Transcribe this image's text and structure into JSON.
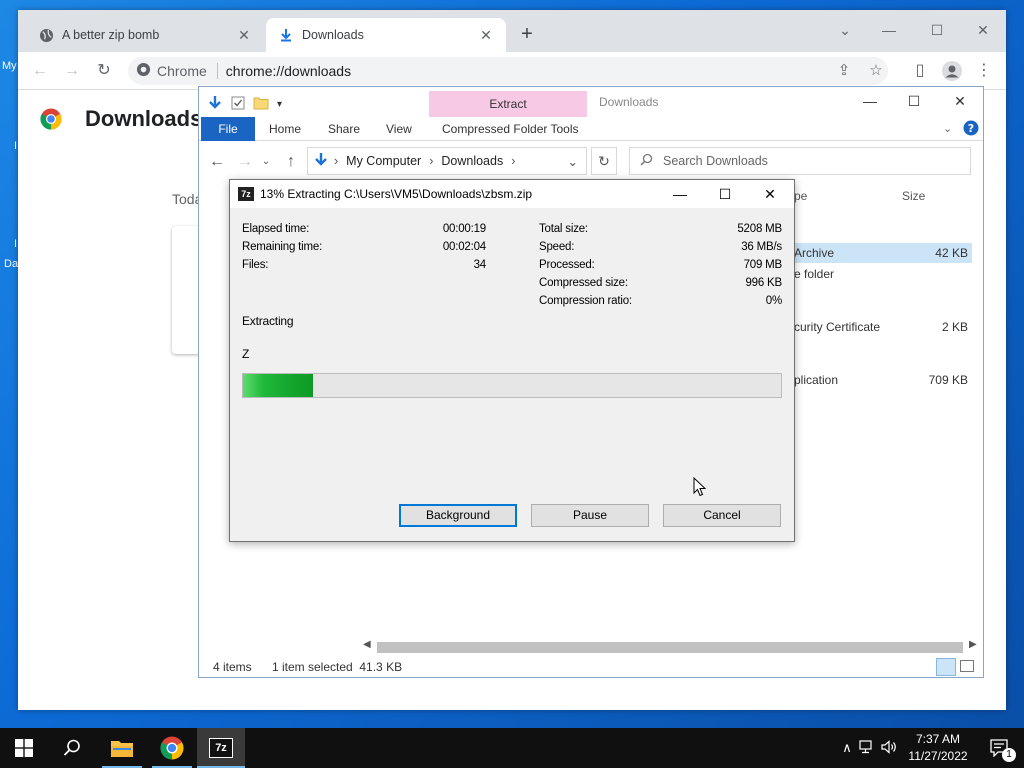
{
  "desktop": {
    "labels": [
      "My",
      "I",
      "I",
      "Da"
    ]
  },
  "chrome": {
    "tabs": [
      {
        "label": "A better zip bomb",
        "active": false
      },
      {
        "label": "Downloads",
        "active": true
      }
    ],
    "omnibox": {
      "site": "Chrome",
      "url": "chrome://downloads"
    },
    "page_title": "Downloads",
    "section_label": "Toda"
  },
  "explorer": {
    "context_tab": "Extract",
    "title": "Downloads",
    "ribbon_tabs": [
      "File",
      "Home",
      "Share",
      "View",
      "Compressed Folder Tools"
    ],
    "breadcrumb": [
      "My Computer",
      "Downloads"
    ],
    "search_placeholder": "Search Downloads",
    "columns": {
      "type": "pe",
      "size": "Size"
    },
    "rows": [
      {
        "type": "Archive",
        "size": "42 KB",
        "selected": true
      },
      {
        "type": "e folder",
        "size": ""
      },
      {
        "type": "curity Certificate",
        "size": "2 KB"
      },
      {
        "type": "plication",
        "size": "709 KB"
      }
    ],
    "status": {
      "items": "4 items",
      "selected": "1 item selected  41.3 KB"
    }
  },
  "sevenzip": {
    "title": "13% Extracting C:\\Users\\VM5\\Downloads\\zbsm.zip",
    "icon_text": "7z",
    "left": [
      {
        "label": "Elapsed time:",
        "value": "00:00:19"
      },
      {
        "label": "Remaining time:",
        "value": "00:02:04"
      },
      {
        "label": "Files:",
        "value": "34"
      }
    ],
    "right": [
      {
        "label": "Total size:",
        "value": "5208 MB"
      },
      {
        "label": "Speed:",
        "value": "36 MB/s"
      },
      {
        "label": "Processed:",
        "value": "709 MB"
      },
      {
        "label": "Compressed size:",
        "value": "996 KB"
      },
      {
        "label": "Compression ratio:",
        "value": "0%"
      }
    ],
    "status_text": "Extracting",
    "current_file": "Z",
    "progress": 0.13,
    "buttons": {
      "background": "Background",
      "pause": "Pause",
      "cancel": "Cancel"
    }
  },
  "taskbar": {
    "time": "7:37 AM",
    "date": "11/27/2022",
    "notification_count": "1",
    "app_7z_label": "7z"
  },
  "colors": {
    "accent": "#0078d7",
    "progress_green": "#13a52c",
    "ribbon_context": "#f8c9e4",
    "file_tab": "#1a64c4"
  }
}
